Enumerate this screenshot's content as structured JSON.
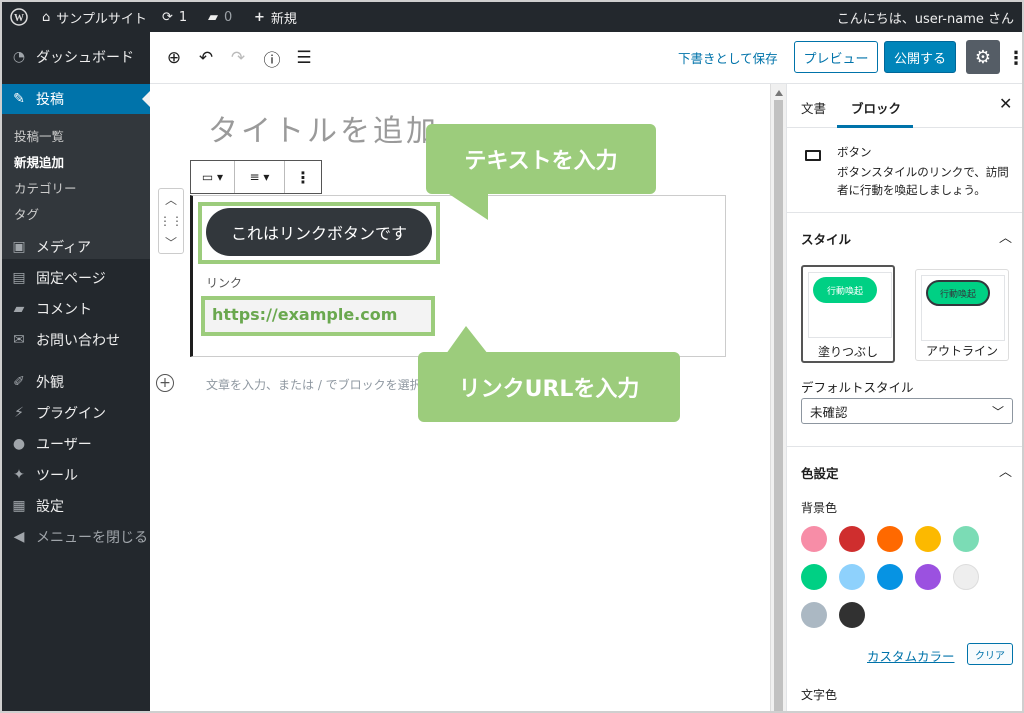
{
  "adminbar": {
    "site_name": "サンプルサイト",
    "updates_count": "1",
    "comments_count": "0",
    "new_label": "新規",
    "greeting": "こんにちは、user-name さん"
  },
  "sidebar": {
    "items": [
      {
        "label": "ダッシュボード",
        "icon": "dashboard-icon"
      },
      {
        "label": "投稿",
        "icon": "pin-icon"
      },
      {
        "label": "メディア",
        "icon": "media-icon"
      },
      {
        "label": "固定ページ",
        "icon": "page-icon"
      },
      {
        "label": "コメント",
        "icon": "comment-icon"
      },
      {
        "label": "お問い合わせ",
        "icon": "mail-icon"
      },
      {
        "label": "外観",
        "icon": "brush-icon"
      },
      {
        "label": "プラグイン",
        "icon": "plugin-icon"
      },
      {
        "label": "ユーザー",
        "icon": "user-icon"
      },
      {
        "label": "ツール",
        "icon": "wrench-icon"
      },
      {
        "label": "設定",
        "icon": "settings-icon"
      },
      {
        "label": "メニューを閉じる",
        "icon": "collapse-icon"
      }
    ],
    "submenu": [
      "投稿一覧",
      "新規追加",
      "カテゴリー",
      "タグ"
    ]
  },
  "toolbar": {
    "save_draft": "下書きとして保存",
    "preview": "プレビュー",
    "publish": "公開する"
  },
  "editor": {
    "title_placeholder": "タイトルを追加",
    "button_text": "これはリンクボタンです",
    "link_label": "リンク",
    "link_url": "https://example.com",
    "paragraph_placeholder": "文章を入力、または / でブロックを選択"
  },
  "callouts": {
    "text": "テキストを入力",
    "url": "リンクURLを入力"
  },
  "panel": {
    "tab_document": "文書",
    "tab_block": "ブロック",
    "block_name": "ボタン",
    "block_desc": "ボタンスタイルのリンクで、訪問者に行動を喚起しましょう。",
    "style_title": "スタイル",
    "style_fill_preview": "行動喚起",
    "style_outline_preview": "行動喚起",
    "style_fill_label": "塗りつぶし",
    "style_outline_label": "アウトライン",
    "default_style_label": "デフォルトスタイル",
    "default_style_value": "未確認",
    "color_title": "色設定",
    "bg_color_label": "背景色",
    "custom_color": "カスタムカラー",
    "clear": "クリア",
    "text_color_label": "文字色"
  },
  "swatches": [
    "#f78da7",
    "#cf2e2e",
    "#ff6900",
    "#fcb900",
    "#7bdcb5",
    "#00d084",
    "#8ed1fc",
    "#0693e3",
    "#9b51e0",
    "#eeeeee",
    "#abb8c3",
    "#313131"
  ]
}
